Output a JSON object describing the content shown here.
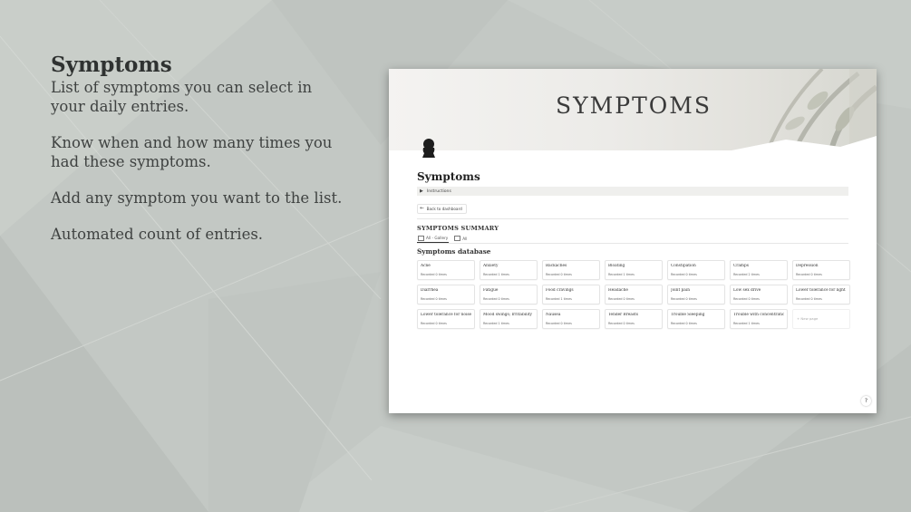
{
  "promo": {
    "title": "Symptoms",
    "paragraphs": [
      "List of symptoms you can select in your daily entries.",
      "Know when and how many times you had these symptoms.",
      "Add any symptom you want to the list.",
      "Automated count of entries."
    ]
  },
  "window": {
    "cover_title": "SYMPTOMS",
    "page_icon": "person-bust-icon",
    "page_heading": "Symptoms",
    "toggle_label": "Instructions",
    "back_button_label": "Back to dashboard",
    "summary_heading": "SYMPTOMS SUMMARY",
    "view_tabs": [
      {
        "label": "All - Gallery",
        "icon": "gallery-icon"
      },
      {
        "label": "All",
        "icon": "table-icon"
      }
    ],
    "database_title": "Symptoms database",
    "cards": [
      {
        "name": "Acne",
        "recorded": "Recorded 0 times"
      },
      {
        "name": "Anxiety",
        "recorded": "Recorded 1 times"
      },
      {
        "name": "Backaches",
        "recorded": "Recorded 0 times"
      },
      {
        "name": "Bloating",
        "recorded": "Recorded 1 times"
      },
      {
        "name": "Constipation",
        "recorded": "Recorded 0 times"
      },
      {
        "name": "Cramps",
        "recorded": "Recorded 2 times"
      },
      {
        "name": "Depression",
        "recorded": "Recorded 0 times"
      },
      {
        "name": "Diarrhea",
        "recorded": "Recorded 0 times"
      },
      {
        "name": "Fatigue",
        "recorded": "Recorded 0 times"
      },
      {
        "name": "Food cravings",
        "recorded": "Recorded 1 times"
      },
      {
        "name": "Headache",
        "recorded": "Recorded 0 times"
      },
      {
        "name": "Joint pain",
        "recorded": "Recorded 0 times"
      },
      {
        "name": "Low sex drive",
        "recorded": "Recorded 0 times"
      },
      {
        "name": "Lower tolerance for light",
        "recorded": "Recorded 0 times"
      },
      {
        "name": "Lower tolerance for noise",
        "recorded": "Recorded 0 times"
      },
      {
        "name": "Mood swings; Irritability",
        "recorded": "Recorded 1 times"
      },
      {
        "name": "Nausea",
        "recorded": "Recorded 0 times"
      },
      {
        "name": "Tender Breasts",
        "recorded": "Recorded 0 times"
      },
      {
        "name": "Trouble Sleeping",
        "recorded": "Recorded 0 times"
      },
      {
        "name": "Trouble with concentration",
        "recorded": "Recorded 1 times"
      }
    ],
    "new_page_label": "+ New page",
    "help_label": "?"
  }
}
